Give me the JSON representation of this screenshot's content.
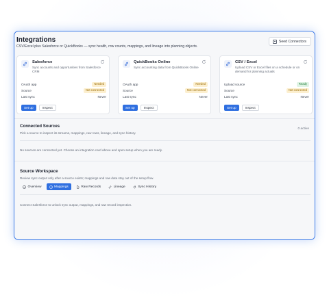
{
  "header": {
    "title": "Integrations",
    "subtitle": "CSV/Excel plus Salesforce or QuickBooks — sync health, row counts, mappings, and lineage into planning objects.",
    "seed_button": "Seed Connectors"
  },
  "cards": [
    {
      "name": "Salesforce",
      "description": "Sync accounts and opportunities from Salesforce CRM",
      "icon": "link-icon",
      "rows": [
        {
          "label": "OAuth app",
          "value": "Needed",
          "badge": "warn"
        },
        {
          "label": "Source",
          "value": "Not connected",
          "badge": "warn"
        },
        {
          "label": "Last sync",
          "value": "Never",
          "badge": ""
        }
      ],
      "primary": "Set up",
      "secondary": "Inspect"
    },
    {
      "name": "QuickBooks Online",
      "description": "Sync accounting data from QuickBooks Online",
      "icon": "link-icon",
      "rows": [
        {
          "label": "OAuth app",
          "value": "Needed",
          "badge": "warn"
        },
        {
          "label": "Source",
          "value": "Not connected",
          "badge": "warn"
        },
        {
          "label": "Last sync",
          "value": "Never",
          "badge": ""
        }
      ],
      "primary": "Set up",
      "secondary": "Inspect"
    },
    {
      "name": "CSV / Excel",
      "description": "Upload CSV or Excel files on a schedule or on demand for planning actuals",
      "icon": "link-icon",
      "rows": [
        {
          "label": "Upload source",
          "value": "Ready",
          "badge": "ok"
        },
        {
          "label": "Source",
          "value": "Not connected",
          "badge": "warn"
        },
        {
          "label": "Last sync",
          "value": "Never",
          "badge": ""
        }
      ],
      "primary": "Set up",
      "secondary": "Inspect"
    }
  ],
  "connected": {
    "title": "Connected Sources",
    "description": "Pick a source to inspect its streams, mappings, raw rows, lineage, and sync history.",
    "active": "0 active",
    "empty": "No sources are connected yet. Choose an integration card above and open setup when you are ready."
  },
  "workspace": {
    "title": "Source Workspace",
    "description": "Review sync output only after a source exists; mappings and raw data stay out of the setup flow.",
    "tabs": [
      {
        "label": "Overview",
        "icon": "overview-icon",
        "active": false
      },
      {
        "label": "Mappings",
        "icon": "mappings-icon",
        "active": true
      },
      {
        "label": "Raw Records",
        "icon": "records-icon",
        "active": false
      },
      {
        "label": "Lineage",
        "icon": "lineage-icon",
        "active": false
      },
      {
        "label": "Sync History",
        "icon": "history-icon",
        "active": false
      }
    ],
    "note": "Connect Salesforce to unlock sync output, mappings, and raw record inspection."
  },
  "colors": {
    "accent": "#2f6fe0",
    "frame": "#3d7be8",
    "warn_bg": "#fcefcf",
    "warn_text": "#9a6a00",
    "ok_bg": "#dff3e4",
    "ok_text": "#25803e"
  }
}
